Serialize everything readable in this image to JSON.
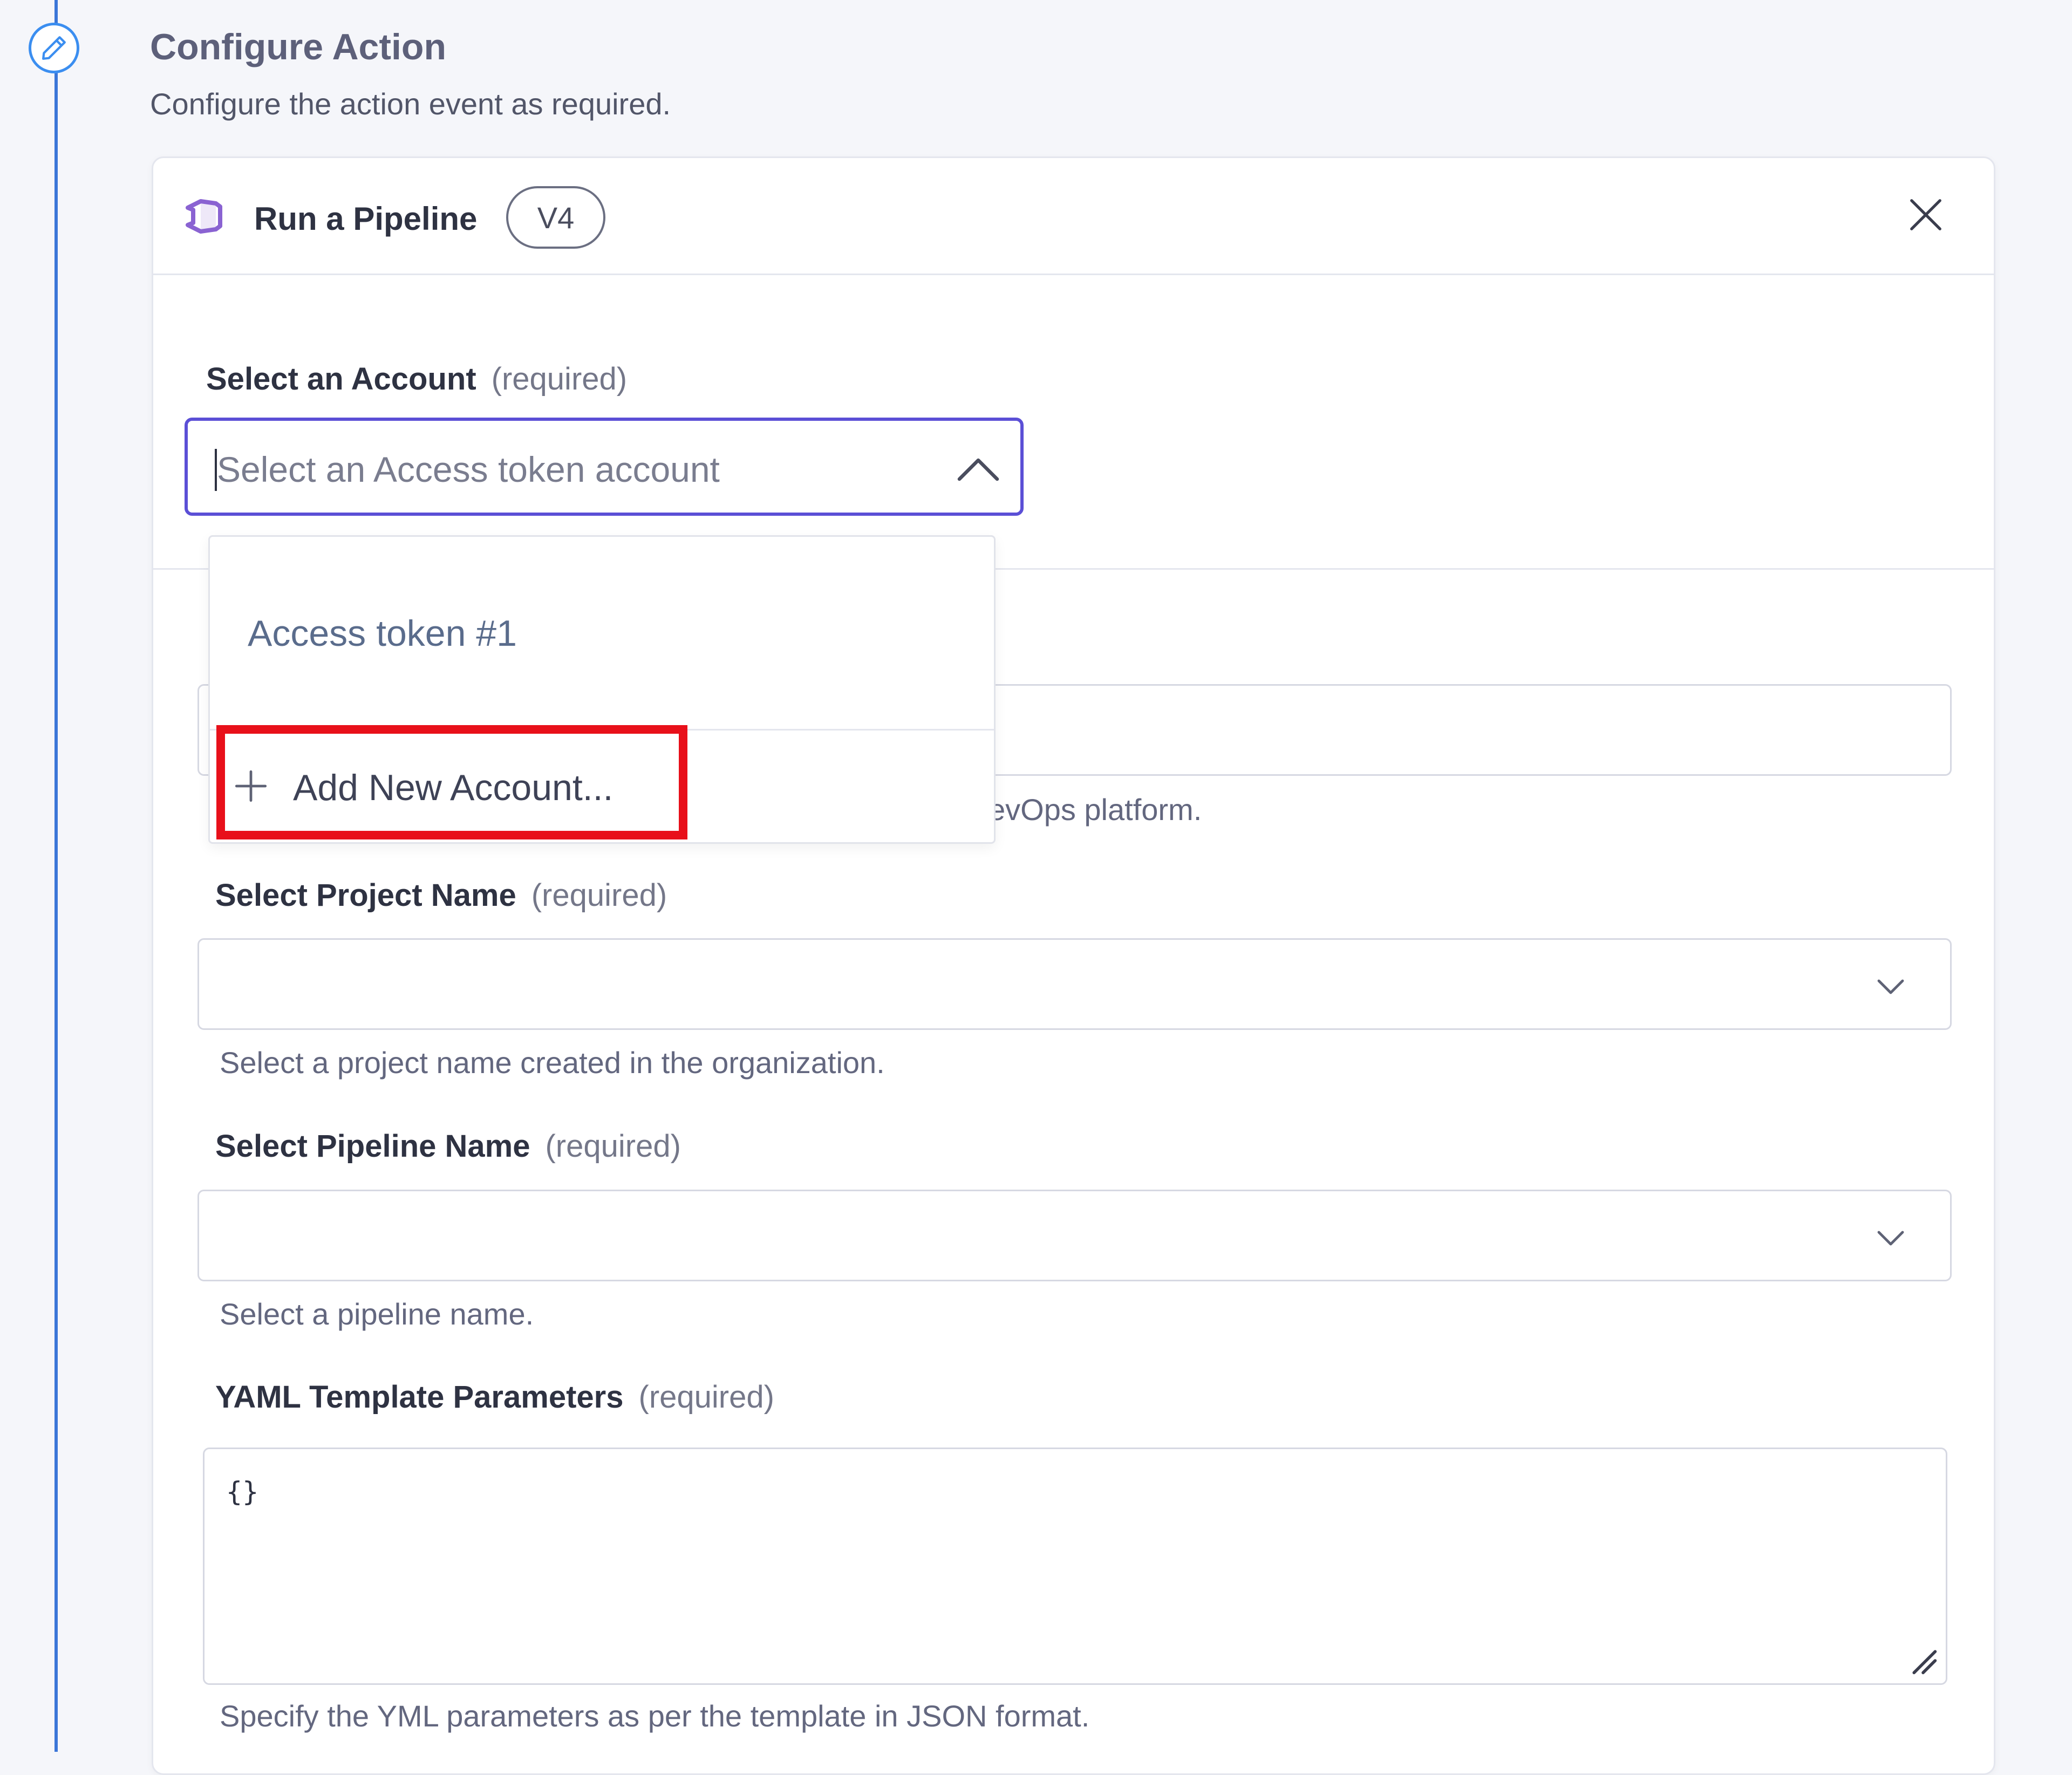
{
  "step": {
    "title": "Configure Action",
    "description": "Configure the action event as required."
  },
  "card": {
    "title": "Run a Pipeline",
    "version": "V4",
    "app_icon": "azure-devops-icon",
    "close_icon": "close-icon"
  },
  "account": {
    "label": "Select an Account",
    "required": "(required)",
    "placeholder": "Select an Access token account",
    "expanded": true
  },
  "dropdown": {
    "options": [
      {
        "label": "Access token #1"
      }
    ],
    "add_new_label": "Add New Account..."
  },
  "org_help_text": "evOps platform.",
  "project": {
    "label": "Select Project Name",
    "required": "(required)",
    "help": "Select a project name created in the organization."
  },
  "pipeline": {
    "label": "Select Pipeline Name",
    "required": "(required)",
    "help": "Select a pipeline name."
  },
  "yaml": {
    "label": "YAML Template Parameters",
    "required": "(required)",
    "value": "{}",
    "help": "Specify the YML parameters as per the template in JSON format."
  },
  "colors": {
    "accent": "#5b4fd6",
    "timeline": "#3b76d8",
    "highlight": "#e8101a"
  }
}
